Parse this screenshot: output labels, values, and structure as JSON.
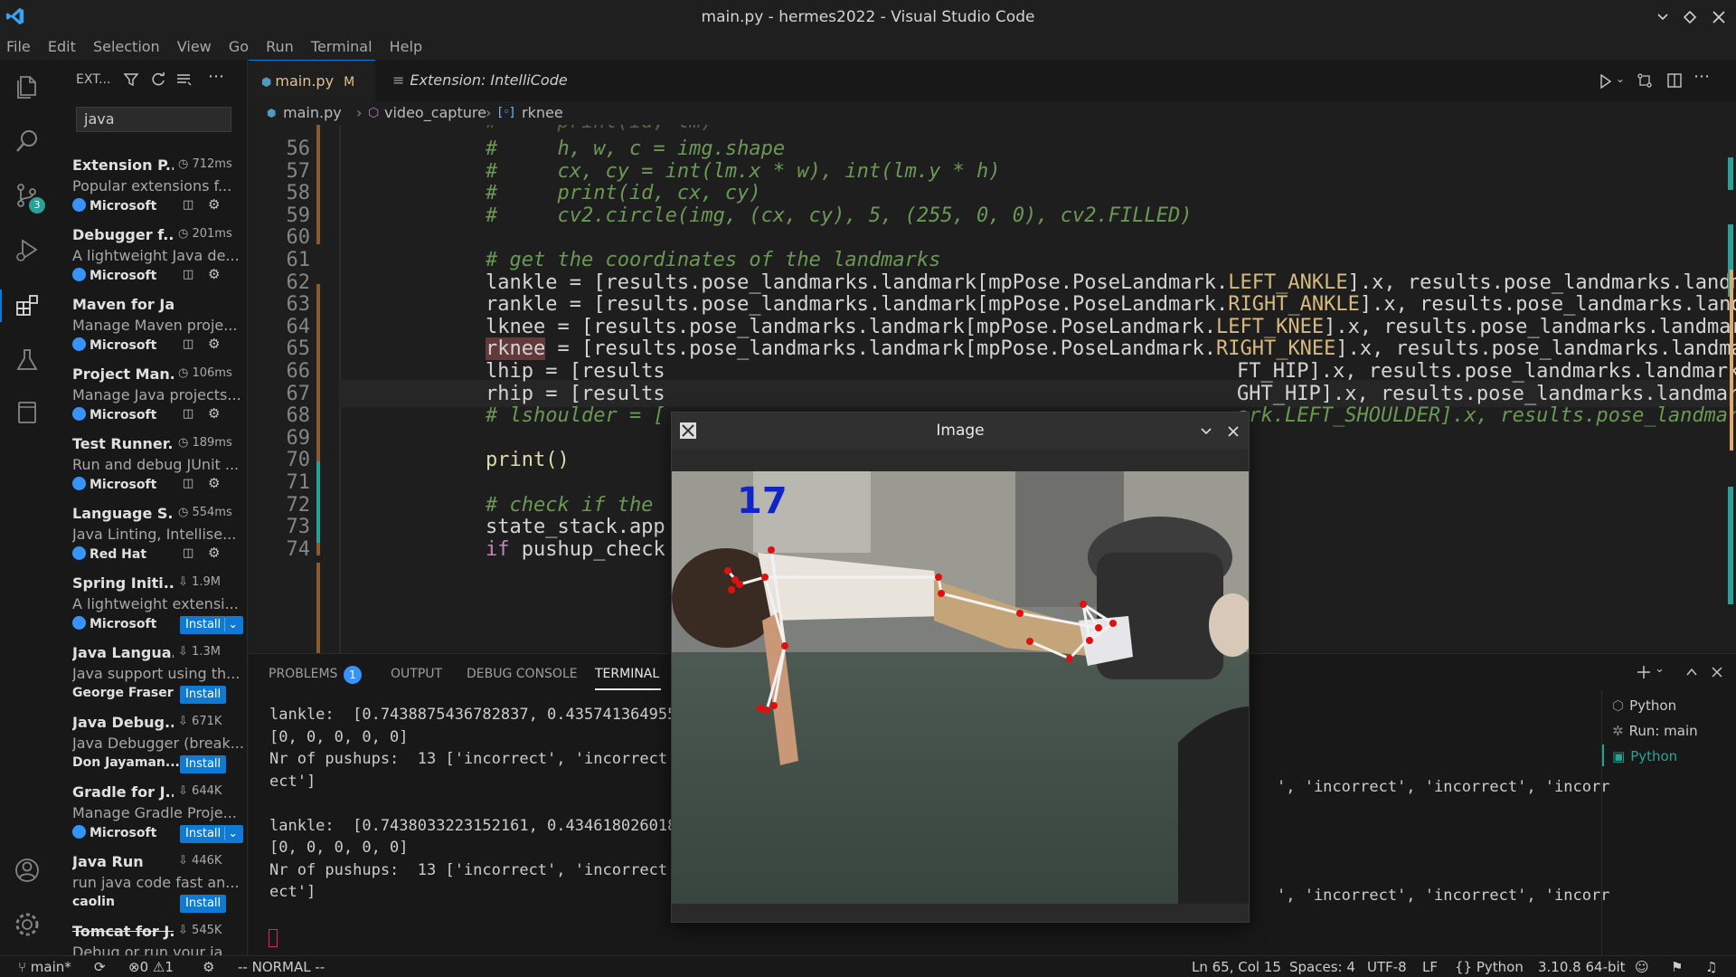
{
  "window": {
    "title": "main.py - hermes2022 - Visual Studio Code"
  },
  "menu": [
    "File",
    "Edit",
    "Selection",
    "View",
    "Go",
    "Run",
    "Terminal",
    "Help"
  ],
  "activity": {
    "scm_badge": "3"
  },
  "sidebar": {
    "header": "EXT...",
    "search_value": "java",
    "extensions": [
      {
        "name": "Extension P...",
        "meta": "712ms",
        "desc": "Popular extensions f...",
        "publisher": "Microsoft",
        "verified": true,
        "install": ""
      },
      {
        "name": "Debugger f...",
        "meta": "201ms",
        "desc": "A lightweight Java de...",
        "publisher": "Microsoft",
        "verified": true,
        "install": ""
      },
      {
        "name": "Maven for Java",
        "meta": "",
        "desc": "Manage Maven proje...",
        "publisher": "Microsoft",
        "verified": true,
        "install": ""
      },
      {
        "name": "Project Man...",
        "meta": "106ms",
        "desc": "Manage Java projects...",
        "publisher": "Microsoft",
        "verified": true,
        "install": ""
      },
      {
        "name": "Test Runner...",
        "meta": "189ms",
        "desc": "Run and debug JUnit ...",
        "publisher": "Microsoft",
        "verified": true,
        "install": ""
      },
      {
        "name": "Language S...",
        "meta": "554ms",
        "desc": "Java Linting, Intellise...",
        "publisher": "Red Hat",
        "verified": true,
        "install": ""
      },
      {
        "name": "Spring Initi...",
        "meta": "1.9M",
        "desc": "A lightweight extensi...",
        "publisher": "Microsoft",
        "verified": true,
        "install": "Install"
      },
      {
        "name": "Java Langua...",
        "meta": "1.3M",
        "desc": "Java support using th...",
        "publisher": "George Fraser",
        "verified": false,
        "install": "Install"
      },
      {
        "name": "Java Debug...",
        "meta": "671K",
        "desc": "Java Debugger (break...",
        "publisher": "Don Jayaman...",
        "verified": false,
        "install": "Install"
      },
      {
        "name": "Gradle for J...",
        "meta": "644K",
        "desc": "Manage Gradle Proje...",
        "publisher": "Microsoft",
        "verified": true,
        "install": "Install"
      },
      {
        "name": "Java Run",
        "meta": "446K",
        "desc": "run java code fast an...",
        "publisher": "caolin",
        "verified": false,
        "install": "Install"
      },
      {
        "name": "Tomcat for J...",
        "meta": "545K",
        "desc": "Debug or run your ja...",
        "publisher": "",
        "verified": false,
        "install": ""
      }
    ]
  },
  "tabs": [
    {
      "label": "main.py",
      "modified": "M",
      "active": true
    },
    {
      "label": "Extension: IntelliCode",
      "active": false
    }
  ],
  "breadcrumb": [
    "main.py",
    "video_capture",
    "rknee"
  ],
  "editor": {
    "lines": [
      {
        "n": "56",
        "text": "#     h, w, c = img.shape",
        "type": "comment"
      },
      {
        "n": "57",
        "text": "#     cx, cy = int(lm.x * w), int(lm.y * h)",
        "type": "comment"
      },
      {
        "n": "58",
        "text": "#     print(id, cx, cy)",
        "type": "comment"
      },
      {
        "n": "59",
        "text": "#     cv2.circle(img, (cx, cy), 5, (255, 0, 0), cv2.FILLED)",
        "type": "comment"
      },
      {
        "n": "60",
        "text": "",
        "type": "plain"
      },
      {
        "n": "61",
        "text": "# get the coordinates of the landmarks",
        "type": "comment"
      },
      {
        "n": "62",
        "pre": "lankle = [results.pose_landmarks.landmark[mpPose.PoseLandmark.",
        "const": "LEFT_ANKLE",
        "post": "].x, results.pose_landmarks.landmark",
        "type": "landmark"
      },
      {
        "n": "63",
        "pre": "rankle = [results.pose_landmarks.landmark[mpPose.PoseLandmark.",
        "const": "RIGHT_ANKLE",
        "post": "].x, results.pose_landmarks.landmark",
        "type": "landmark"
      },
      {
        "n": "64",
        "pre": "lknee = [results.pose_landmarks.landmark[mpPose.PoseLandmark.",
        "const": "LEFT_KNEE",
        "post": "].x, results.pose_landmarks.landmark",
        "type": "landmark"
      },
      {
        "n": "65",
        "pre": "rknee = [results.pose_landmarks.landmark[mpPose.PoseLandmark.",
        "const": "RIGHT_KNEE",
        "post": "].x, results.pose_landmarks.landmark",
        "type": "landmark"
      },
      {
        "n": "66",
        "text": "lhip = [results",
        "tail": "FT_HIP].x, results.pose_landmarks.landmark",
        "type": "split"
      },
      {
        "n": "67",
        "text": "rhip = [results",
        "tail": "GHT_HIP].x, results.pose_landmarks.landmark",
        "type": "split"
      },
      {
        "n": "68",
        "text": "# lshoulder = [",
        "tail": "ark.LEFT_SHOULDER].x, results.pose_landmarks",
        "type": "split-comment"
      },
      {
        "n": "69",
        "text": "",
        "type": "plain"
      },
      {
        "n": "70",
        "text": "print()",
        "type": "print"
      },
      {
        "n": "71",
        "text": "",
        "type": "plain"
      },
      {
        "n": "72",
        "text": "# check if the",
        "type": "comment"
      },
      {
        "n": "73",
        "text": "state_stack.app",
        "type": "plain"
      },
      {
        "n": "74",
        "text": "if pushup_check",
        "type": "if"
      }
    ]
  },
  "panel": {
    "tabs": [
      "PROBLEMS",
      "OUTPUT",
      "DEBUG CONSOLE",
      "TERMINAL"
    ],
    "problems_count": "1",
    "terminal": [
      "lankle:  [0.7438875436782837, 0.435741364955",
      "[0, 0, 0, 0, 0]",
      "Nr of pushups:  13 ['incorrect', 'incorrect'",
      "ect']",
      "",
      "lankle:  [0.7438033223152161, 0.434618026018",
      "[0, 0, 0, 0, 0]",
      "Nr of pushups:  13 ['incorrect', 'incorrect'",
      "ect']"
    ],
    "terminal_tail": "', 'incorrect', 'incorrect', 'incorr",
    "sessions": [
      "Python",
      "Run: main",
      "Python"
    ]
  },
  "image_window": {
    "title": "Image",
    "count": "17"
  },
  "status": {
    "branch": "main*",
    "errors": "0",
    "warnings": "1",
    "mode": "-- NORMAL --",
    "position": "Ln 65, Col 15",
    "spaces": "Spaces: 4",
    "encoding": "UTF-8",
    "eol": "LF",
    "language": "Python",
    "interpreter": "3.10.8 64-bit"
  },
  "colors": {
    "accent": "#0e7ad3",
    "comment": "#6a9955",
    "terminal_active": "#2aa198"
  }
}
